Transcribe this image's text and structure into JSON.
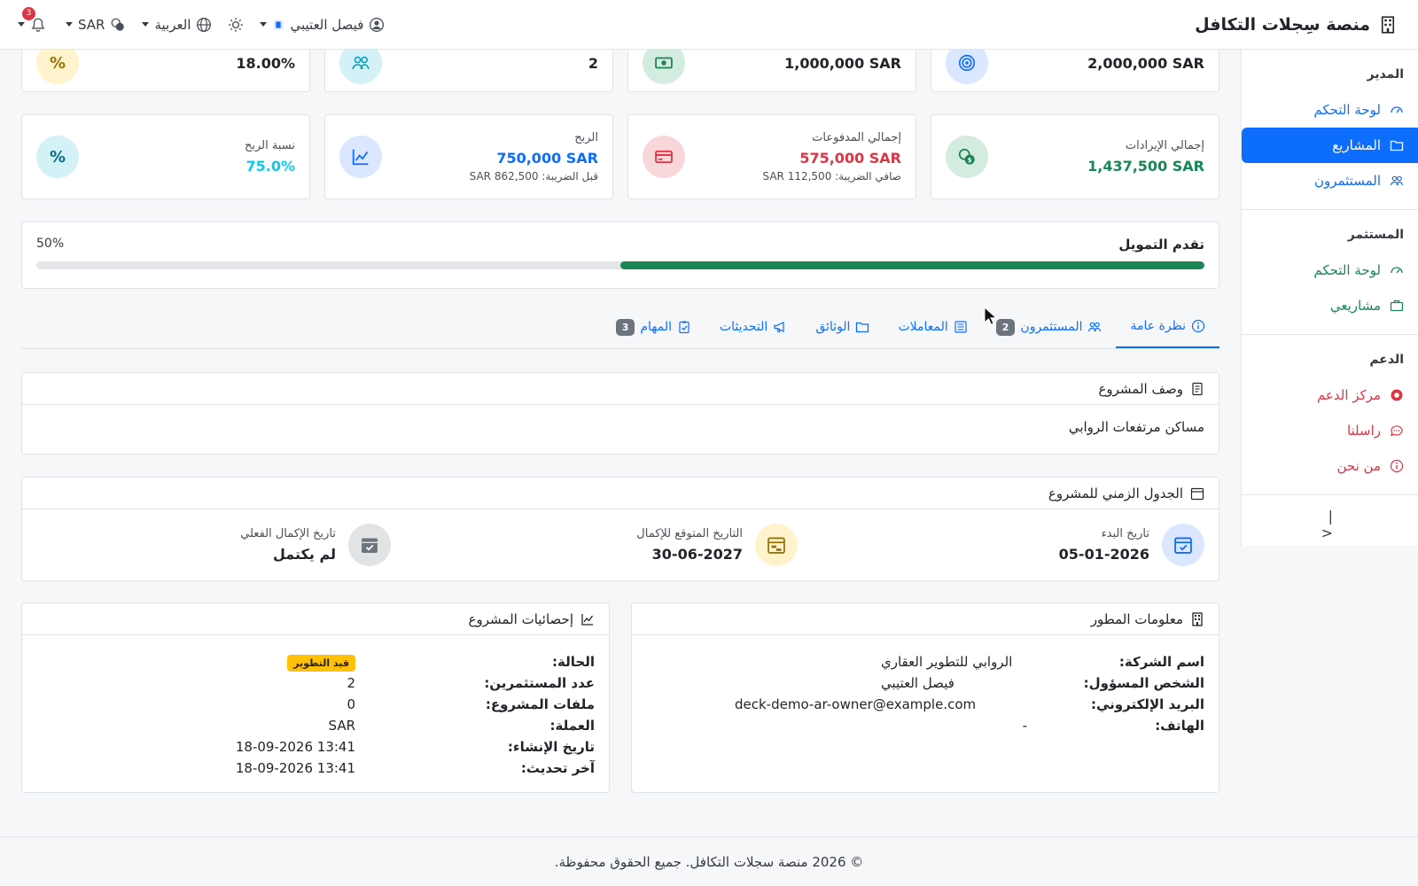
{
  "header": {
    "brand": "منصة سِجلات التكافل",
    "user_name": "فيصل العتيبي",
    "language": "العربية",
    "currency": "SAR",
    "notif_count": "3"
  },
  "sidebar": {
    "sections": [
      {
        "title": "المدير",
        "items": [
          "لوحة التحكم",
          "المشاريع",
          "المستثمرون"
        ]
      },
      {
        "title": "المستثمر",
        "items": [
          "لوحة التحكم",
          "مشاريعي"
        ]
      },
      {
        "title": "الدعم",
        "items": [
          "مركز الدعم",
          "راسلنا",
          "من نحن"
        ]
      }
    ],
    "collapse_icon": "|<"
  },
  "stats_top": [
    {
      "value": "2,000,000 SAR"
    },
    {
      "value": "1,000,000 SAR"
    },
    {
      "value": "2"
    },
    {
      "value": "18.00%"
    }
  ],
  "stats": [
    {
      "label": "إجمالي الإيرادات",
      "value": "1,437,500 SAR",
      "sub": ""
    },
    {
      "label": "إجمالي المدفوعات",
      "value": "575,000 SAR",
      "sub": "صافي الضريبة: 112,500 SAR"
    },
    {
      "label": "الربح",
      "value": "750,000 SAR",
      "sub": "قبل الضريبة: 862,500 SAR"
    },
    {
      "label": "نسبة الربح",
      "value": "75.0%",
      "sub": ""
    }
  ],
  "percent_glyph": "%",
  "funding": {
    "title": "تقدم التمويل",
    "percent_label": "50%",
    "percent": 50
  },
  "tabs": [
    {
      "label": "نظرة عامة",
      "badge": ""
    },
    {
      "label": "المستثمرون",
      "badge": "2"
    },
    {
      "label": "المعاملات",
      "badge": ""
    },
    {
      "label": "الوثائق",
      "badge": ""
    },
    {
      "label": "التحديثات",
      "badge": ""
    },
    {
      "label": "المهام",
      "badge": "3"
    }
  ],
  "description": {
    "title": "وصف المشروع",
    "text": "مساكن مرتفعات الروابي"
  },
  "timeline": {
    "title": "الجدول الزمني للمشروع",
    "start_label": "تاريخ البدء",
    "start_value": "05-01-2026",
    "expected_label": "التاريخ المتوقع للإكمال",
    "expected_value": "30-06-2027",
    "actual_label": "تاريخ الإكمال الفعلي",
    "actual_value": "لم يكتمل"
  },
  "developer": {
    "title": "معلومات المطور",
    "rows": [
      {
        "k": "اسم الشركة:",
        "v": "الروابي للتطوير العقاري"
      },
      {
        "k": "الشخص المسؤول:",
        "v": "فيصل العتيبي"
      },
      {
        "k": "البريد الإلكتروني:",
        "v": "deck-demo-ar-owner@example.com"
      },
      {
        "k": "الهاتف:",
        "v": "-"
      }
    ]
  },
  "project_stats": {
    "title": "إحصائيات المشروع",
    "status_label": "الحالة:",
    "status_value": "قيد التطوير",
    "rows": [
      {
        "k": "عدد المستثمرين:",
        "v": "2"
      },
      {
        "k": "ملفات المشروع:",
        "v": "0"
      },
      {
        "k": "العملة:",
        "v": "SAR"
      },
      {
        "k": "تاريخ الإنشاء:",
        "v": "18-09-2026 13:41"
      },
      {
        "k": "آخر تحديث:",
        "v": "18-09-2026 13:41"
      }
    ]
  },
  "footer": {
    "text": "© 2026 منصة سجلات التكافل. جميع الحقوق محفوظة."
  },
  "colors": {
    "primary": "#0d6efd",
    "success": "#198754",
    "danger": "#dc3545",
    "info": "#0dcaf0",
    "warning": "#ffc107"
  }
}
